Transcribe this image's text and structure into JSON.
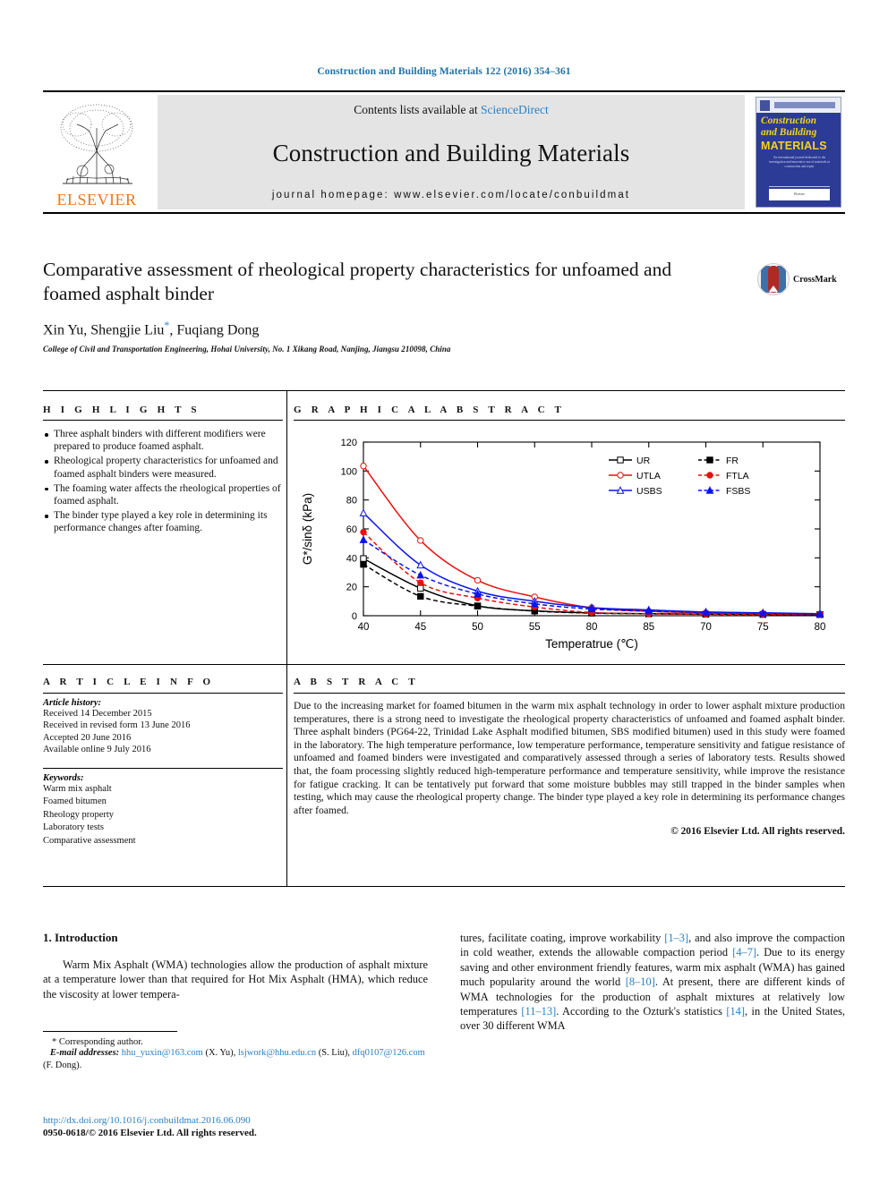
{
  "running_head": "Construction and Building Materials 122 (2016) 354–361",
  "masthead": {
    "contents_prefix": "Contents lists available at ",
    "sciencedirect": "ScienceDirect",
    "journal_title": "Construction and Building Materials",
    "homepage": "journal homepage: www.elsevier.com/locate/conbuildmat",
    "publisher": "ELSEVIER",
    "cover": {
      "line1": "Construction",
      "line2": "and Building",
      "line3": "MATERIALS",
      "blurb": "An international journal dedicated to the investigation and innovative use of materials in construction and repair",
      "foot": "Elsevier"
    }
  },
  "article": {
    "title": "Comparative assessment of rheological property characteristics for unfoamed and foamed asphalt binder",
    "authors": "Xin Yu, Shengjie Liu",
    "authors_tail": ", Fuqiang Dong",
    "corresponding_mark": "*",
    "affiliation": "College of Civil and Transportation Engineering, Hohai University, No. 1 Xikang Road, Nanjing, Jiangsu 210098, China",
    "crossmark_label": "CrossMark"
  },
  "highlights": {
    "heading": "H I G H L I G H T S",
    "items": [
      "Three asphalt binders with different modifiers were prepared to produce foamed asphalt.",
      "Rheological property characteristics for unfoamed and foamed asphalt binders were measured.",
      "The foaming water affects the rheological properties of foamed asphalt.",
      "The binder type played a key role in determining its performance changes after foaming."
    ]
  },
  "graphical_abstract": {
    "heading": "G R A P H I C A L   A B S T R A C T"
  },
  "article_info": {
    "heading": "A R T I C L E   I N F O",
    "history_label": "Article history:",
    "history": [
      "Received 14 December 2015",
      "Received in revised form 13 June 2016",
      "Accepted 20 June 2016",
      "Available online 9 July 2016"
    ],
    "keywords_label": "Keywords:",
    "keywords": [
      "Warm mix asphalt",
      "Foamed bitumen",
      "Rheology property",
      "Laboratory tests",
      "Comparative assessment"
    ]
  },
  "abstract": {
    "heading": "A B S T R A C T",
    "text": "Due to the increasing market for foamed bitumen in the warm mix asphalt technology in order to lower asphalt mixture production temperatures, there is a strong need to investigate the rheological property characteristics of unfoamed and foamed asphalt binder. Three asphalt binders (PG64-22, Trinidad Lake Asphalt modified bitumen, SBS modified bitumen) used in this study were foamed in the laboratory. The high temperature performance, low temperature performance, temperature sensitivity and fatigue resistance of unfoamed and foamed binders were investigated and comparatively assessed through a series of laboratory tests. Results showed that, the foam processing slightly reduced high-temperature performance and temperature sensitivity, while improve the resistance for fatigue cracking. It can be tentatively put forward that some moisture bubbles may still trapped in the binder samples when testing, which may cause the rheological property change. The binder type played a key role in determining its performance changes after foamed.",
    "copyright": "© 2016 Elsevier Ltd. All rights reserved."
  },
  "body": {
    "section_title": "1. Introduction",
    "left_paragraph": "Warm Mix Asphalt (WMA) technologies allow the production of asphalt mixture at a temperature lower than that required for Hot Mix Asphalt (HMA), which reduce the viscosity at lower tempera-",
    "right_paragraph_parts": [
      "tures, facilitate coating, improve workability ",
      "[1–3]",
      ", and also improve the compaction in cold weather, extends the allowable compaction period ",
      "[4–7]",
      ". Due to its energy saving and other environment friendly features, warm mix asphalt (WMA) has gained much popularity around the world ",
      "[8–10]",
      ". At present, there are different kinds of WMA technologies for the production of asphalt mixtures at relatively low temperatures ",
      "[11–13]",
      ". According to the Ozturk's statistics ",
      "[14]",
      ", in the United States, over 30 different WMA"
    ]
  },
  "footnote": {
    "corresponding": "* Corresponding author.",
    "email_label": "E-mail addresses:",
    "emails": [
      {
        "address": "hhu_yuxin@163.com",
        "person": "(X. Yu)"
      },
      {
        "address": "lsjwork@hhu.edu.cn",
        "person": "(S. Liu)"
      },
      {
        "address": "dfq0107@126.com",
        "person": "(F. Dong)"
      }
    ],
    "doi": "http://dx.doi.org/10.1016/j.conbuildmat.2016.06.090",
    "issn": "0950-0618/© 2016 Elsevier Ltd. All rights reserved."
  },
  "chart_data": {
    "type": "line",
    "title": "",
    "xlabel": "Temperatrue (℃)",
    "ylabel": "G*/sinδ (kPa)",
    "x": [
      40,
      45,
      50,
      55,
      80,
      85,
      70,
      75,
      80
    ],
    "xtick_labels": [
      "40",
      "45",
      "50",
      "55",
      "80",
      "85",
      "70",
      "75",
      "80"
    ],
    "ytick_labels": [
      "0",
      "20",
      "40",
      "60",
      "80",
      "100",
      "120"
    ],
    "xlim": [
      40,
      80
    ],
    "ylim": [
      0,
      120
    ],
    "grid": false,
    "legend_position": "top-right",
    "series": [
      {
        "name": "UR",
        "color": "#000000",
        "style": "solid",
        "marker": "open-square",
        "values": [
          39.5,
          19.0,
          6.8,
          3.4,
          1.9,
          1.4,
          1.1,
          0.9,
          0.8
        ]
      },
      {
        "name": "FR",
        "color": "#000000",
        "style": "dashed",
        "marker": "filled-square",
        "values": [
          35.5,
          13.4,
          6.6,
          3.2,
          1.8,
          1.3,
          1.0,
          0.9,
          0.8
        ]
      },
      {
        "name": "UTLA",
        "color": "#e8110f",
        "style": "solid",
        "marker": "open-circle",
        "values": [
          103.5,
          52.0,
          24.5,
          13.0,
          5.5,
          3.0,
          2.0,
          1.5,
          1.2
        ]
      },
      {
        "name": "FTLA",
        "color": "#e8110f",
        "style": "dashed",
        "marker": "filled-circle",
        "values": [
          57.8,
          22.8,
          12.2,
          6.0,
          2.2,
          1.4,
          1.1,
          1.0,
          0.9
        ]
      },
      {
        "name": "USBS",
        "color": "#0a14e8",
        "style": "solid",
        "marker": "open-triangle",
        "values": [
          71.0,
          35.0,
          17.0,
          10.0,
          5.6,
          4.0,
          2.6,
          2.0,
          1.4
        ]
      },
      {
        "name": "FSBS",
        "color": "#0a14e8",
        "style": "dashed",
        "marker": "filled-triangle",
        "values": [
          52.5,
          28.0,
          15.0,
          8.2,
          4.6,
          3.2,
          2.2,
          1.8,
          1.2
        ]
      }
    ]
  }
}
